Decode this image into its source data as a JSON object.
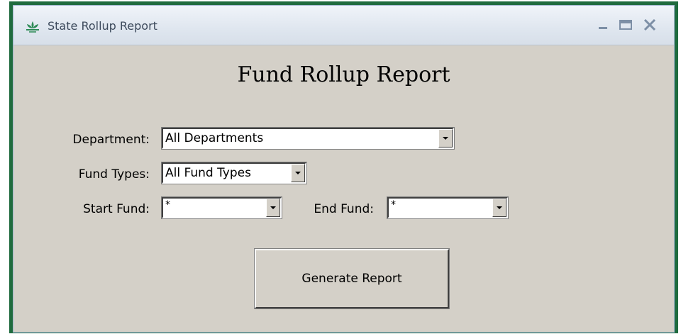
{
  "window": {
    "title": "State Rollup Report",
    "app_icon": "lotus-icon",
    "controls": {
      "minimize": "minimize-icon",
      "maximize": "maximize-icon",
      "close": "close-icon"
    },
    "frame_color": "#1f6b3e"
  },
  "form": {
    "heading": "Fund Rollup Report",
    "department": {
      "label": "Department:",
      "value": "All Departments"
    },
    "fund_types": {
      "label": "Fund Types:",
      "value": "All Fund Types"
    },
    "start_fund": {
      "label": "Start Fund:",
      "value": "*"
    },
    "end_fund": {
      "label": "End Fund:",
      "value": "*"
    },
    "generate_button": "Generate Report"
  }
}
